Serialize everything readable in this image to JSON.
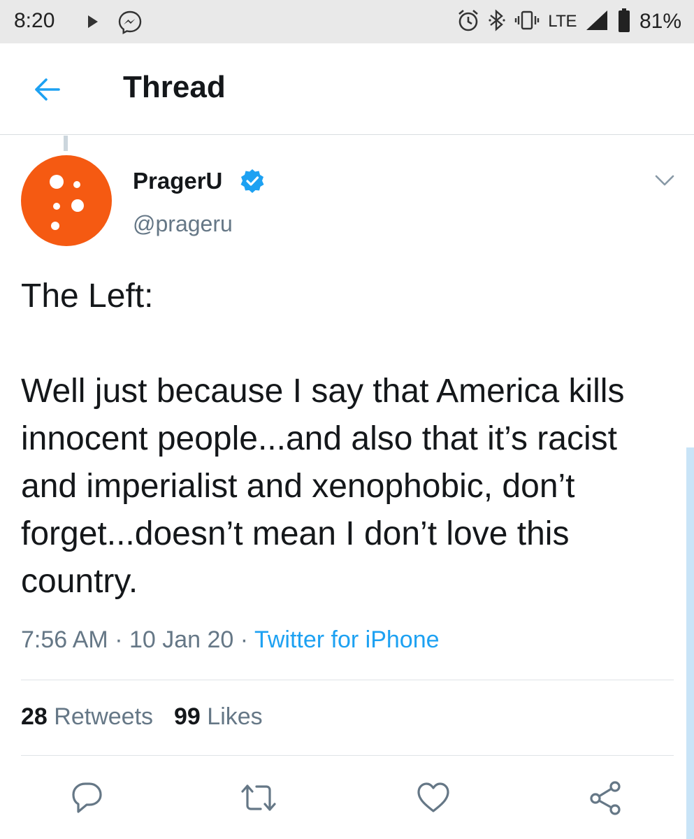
{
  "status_bar": {
    "time": "8:20",
    "network": "LTE",
    "battery": "81%",
    "icons": [
      "play-icon",
      "messenger-icon",
      "alarm-icon",
      "bluetooth-icon",
      "vibrate-icon",
      "signal-icon",
      "battery-icon"
    ]
  },
  "header": {
    "title": "Thread",
    "back_icon": "arrow-left-icon"
  },
  "tweet": {
    "author_name": "PragerU",
    "handle": "@prageru",
    "verified": true,
    "text": "The Left:\n\nWell just because I say that America kills innocent people...and also that it’s racist and imperialist and xenophobic, don’t forget...doesn’t mean I don’t love this country.",
    "time": "7:56 AM",
    "separator": "·",
    "date": "10 Jan 20",
    "source": "Twitter for iPhone",
    "retweet_count": "28",
    "retweet_label": "Retweets",
    "like_count": "99",
    "like_label": "Likes"
  },
  "actions": {
    "icons": [
      "reply-icon",
      "retweet-icon",
      "like-icon",
      "share-icon"
    ]
  },
  "colors": {
    "accent": "#1da1f2",
    "avatar_orange": "#f55a12",
    "secondary_text": "#657786",
    "status_bar_bg": "#e9e9e9"
  }
}
